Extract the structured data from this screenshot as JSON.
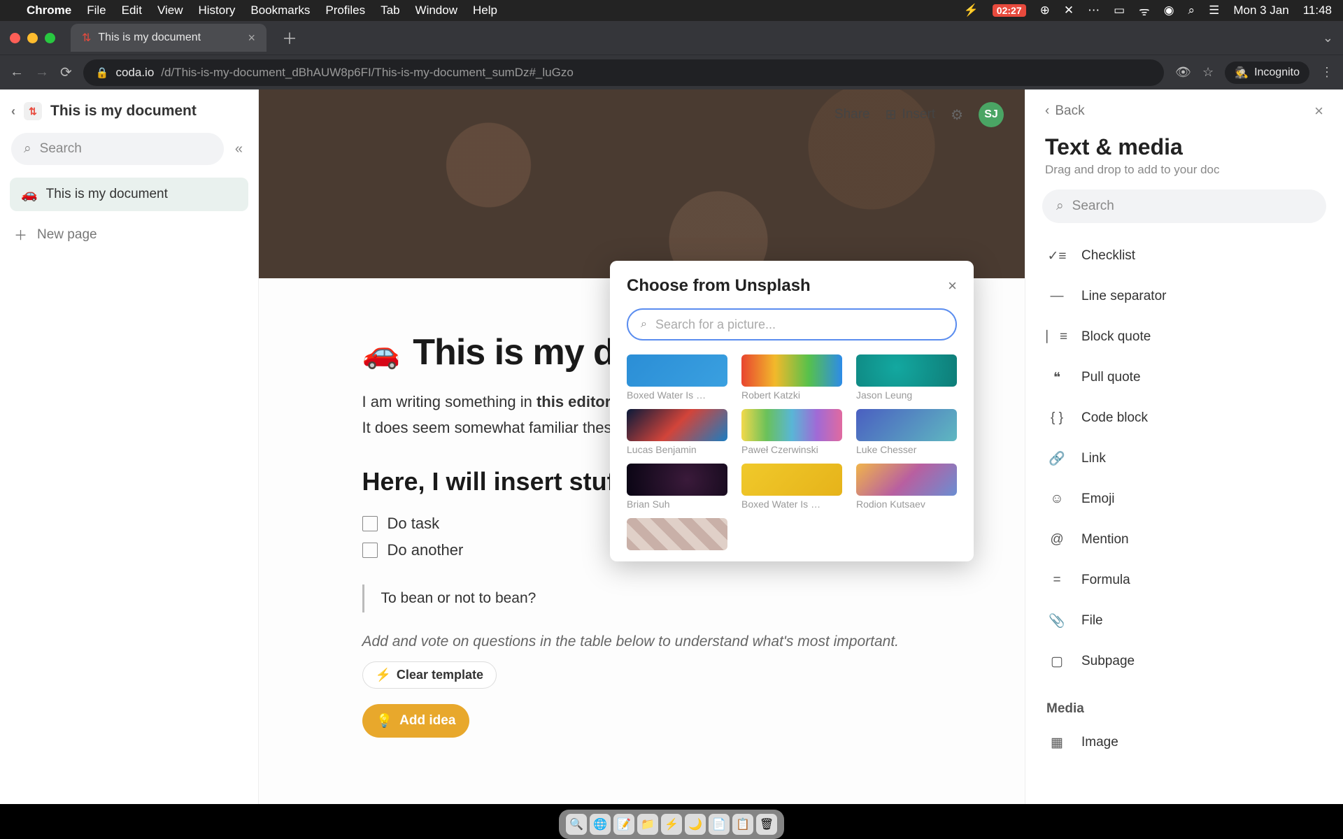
{
  "menubar": {
    "app_name": "Chrome",
    "items": [
      "File",
      "Edit",
      "View",
      "History",
      "Bookmarks",
      "Profiles",
      "Tab",
      "Window",
      "Help"
    ],
    "battery_time": "02:27",
    "date": "Mon 3 Jan",
    "time": "11:48"
  },
  "browser": {
    "tab_title": "This is my document",
    "tab_favicon": "⇅",
    "url_host": "coda.io",
    "url_path": "/d/This-is-my-document_dBhAUW8p6FI/This-is-my-document_sumDz#_luGzo",
    "incognito_label": "Incognito"
  },
  "doc": {
    "back_label": "‹",
    "title_bar": "This is my document",
    "search_placeholder": "Search",
    "page_emoji": "🚗",
    "page_name": "This is my document",
    "new_page_label": "New page"
  },
  "appbar": {
    "share": "Share",
    "insert": "Insert",
    "avatar_initials": "SJ"
  },
  "content": {
    "emoji": "🚗",
    "title": "This is my document",
    "para1_prefix": "I am writing something in ",
    "para1_bold": "this editor",
    "para2": "It does seem somewhat familiar these days",
    "h2": "Here, I will insert stuff",
    "checks": [
      "Do task",
      "Do another"
    ],
    "quote": "To bean or not to bean?",
    "helper": "Add and vote on questions in the table below to understand what's most important.",
    "clear_template": "Clear template",
    "add_idea": "Add idea"
  },
  "panel": {
    "back": "Back",
    "title": "Text & media",
    "subtitle": "Drag and drop to add to your doc",
    "search_placeholder": "Search",
    "items": [
      {
        "icon": "✓≡",
        "label": "Checklist"
      },
      {
        "icon": "—",
        "label": "Line separator"
      },
      {
        "icon": "⎸≡",
        "label": "Block quote"
      },
      {
        "icon": "❝",
        "label": "Pull quote"
      },
      {
        "icon": "{ }",
        "label": "Code block"
      },
      {
        "icon": "🔗",
        "label": "Link"
      },
      {
        "icon": "☺",
        "label": "Emoji"
      },
      {
        "icon": "@",
        "label": "Mention"
      },
      {
        "icon": "=",
        "label": "Formula"
      },
      {
        "icon": "📎",
        "label": "File"
      },
      {
        "icon": "▢",
        "label": "Subpage"
      }
    ],
    "media_heading": "Media",
    "media_item": "Image"
  },
  "modal": {
    "title": "Choose from Unsplash",
    "search_placeholder": "Search for a picture...",
    "thumbs": [
      {
        "author": "Boxed Water Is …",
        "bg": "linear-gradient(135deg,#2b8ed6,#3aa0e0)"
      },
      {
        "author": "Robert Katzki",
        "bg": "linear-gradient(90deg,#e8452f,#f2b92b,#57c14b,#2d8be8)"
      },
      {
        "author": "Jason Leung",
        "bg": "radial-gradient(circle at 40% 40%, #13a8a0, #0e7d78)"
      },
      {
        "author": "Lucas Benjamin",
        "bg": "linear-gradient(135deg,#0a1a3a,#d2443a,#1b7dc1)"
      },
      {
        "author": "Paweł Czerwinski",
        "bg": "linear-gradient(90deg,#f2d94b,#6ac15a,#59b6d6,#a06ad6,#e06aa0)"
      },
      {
        "author": "Luke Chesser",
        "bg": "linear-gradient(135deg,#4a5fc1,#5fb8c1)"
      },
      {
        "author": "Brian Suh",
        "bg": "radial-gradient(circle at 60% 50%, #3a1a3a, #0a0514)"
      },
      {
        "author": "Boxed Water Is …",
        "bg": "linear-gradient(135deg,#f0c92b,#e6b31a)"
      },
      {
        "author": "Rodion Kutsaev",
        "bg": "linear-gradient(135deg,#f0b44b,#b85fa0,#6a8ed2)"
      },
      {
        "author": "",
        "bg": "repeating-linear-gradient(45deg,#c9b0a8 0 14px,#e0d0c8 14px 28px)"
      }
    ]
  },
  "dock": {
    "items": [
      "🔍",
      "🌐",
      "📝",
      "📁",
      "⚡",
      "🌙",
      "📄",
      "📋",
      "🗑"
    ]
  }
}
